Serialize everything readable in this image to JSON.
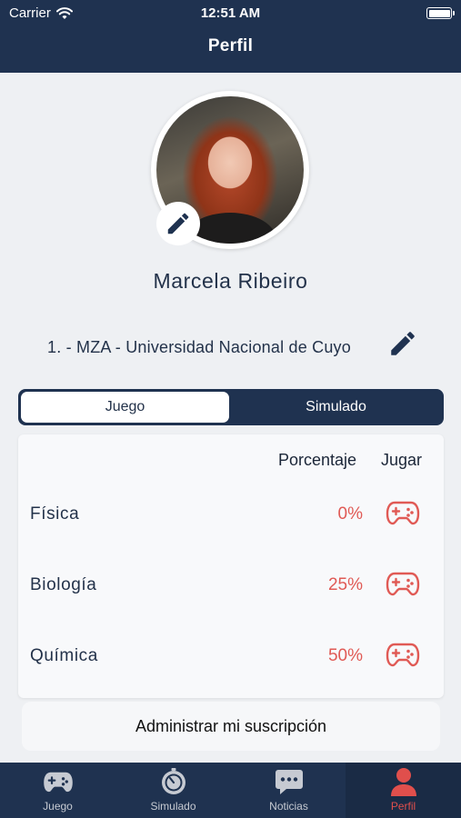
{
  "status_bar": {
    "carrier": "Carrier",
    "time": "12:51 AM"
  },
  "nav": {
    "title": "Perfil"
  },
  "profile": {
    "name": "Marcela Ribeiro",
    "university": "1. - MZA - Universidad Nacional de Cuyo"
  },
  "segmented": {
    "tabs": [
      {
        "label": "Juego",
        "selected": true
      },
      {
        "label": "Simulado",
        "selected": false
      }
    ]
  },
  "table": {
    "headers": {
      "percent": "Porcentaje",
      "play": "Jugar"
    },
    "rows": [
      {
        "subject": "Física",
        "percent": "0%"
      },
      {
        "subject": "Biología",
        "percent": "25%"
      },
      {
        "subject": "Química",
        "percent": "50%"
      }
    ]
  },
  "manage_subscription": "Administrar mi suscripción",
  "tabbar": {
    "items": [
      {
        "label": "Juego",
        "icon": "gamepad-icon"
      },
      {
        "label": "Simulado",
        "icon": "stopwatch-icon"
      },
      {
        "label": "Noticias",
        "icon": "chat-bubble-icon"
      },
      {
        "label": "Perfil",
        "icon": "user-icon",
        "active": true
      }
    ]
  },
  "colors": {
    "navy": "#1f3250",
    "accent_red": "#e05a55",
    "background": "#eef0f3"
  }
}
